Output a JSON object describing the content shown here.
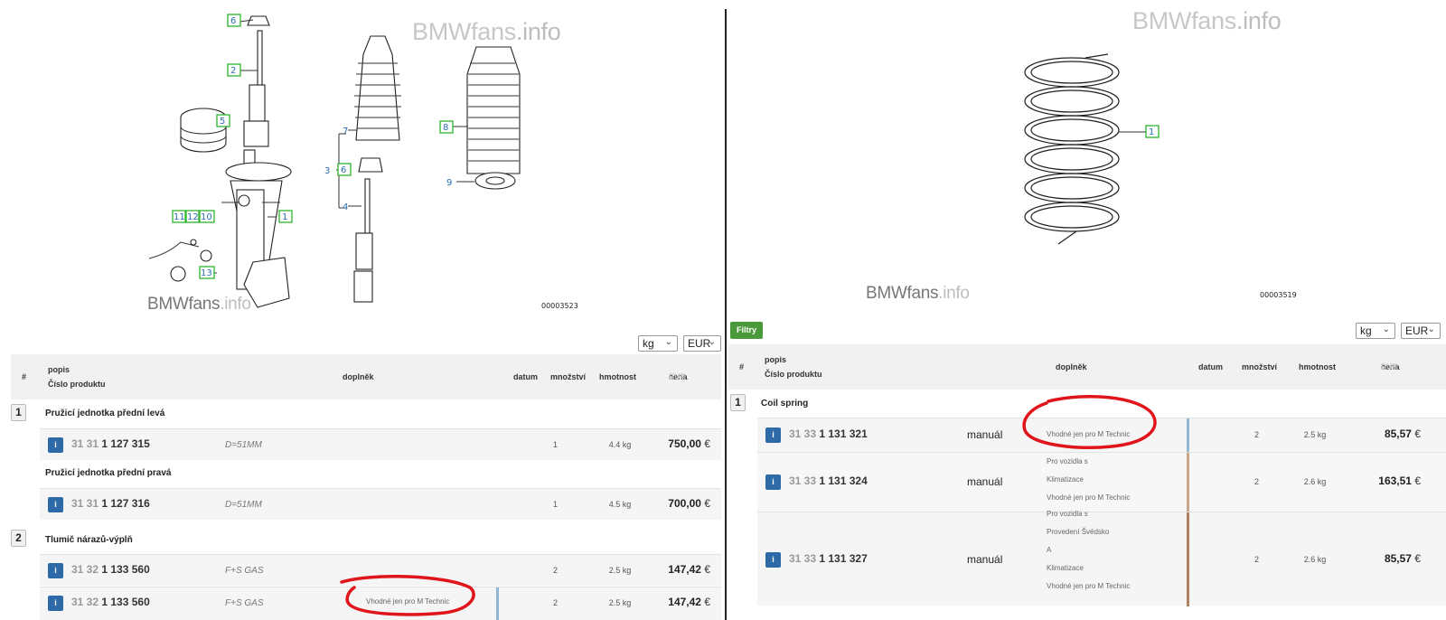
{
  "left": {
    "watermark_top": {
      "brand": "BMWfans",
      "domain": ".info"
    },
    "watermark_bottom": {
      "brand": "BMWfans",
      "domain": ".info"
    },
    "figure_number": "00003523",
    "callouts": [
      "6",
      "2",
      "5",
      "1",
      "11",
      "12",
      "10",
      "13",
      "7",
      "3",
      "6",
      "4",
      "8",
      "9"
    ],
    "unit_select": "kg",
    "currency_select": "EUR",
    "table_header": {
      "num": "#",
      "desc": "popis",
      "product": "Číslo produktu",
      "addition": "doplněk",
      "date": "datum",
      "qty": "množství",
      "weight": "hmotnost",
      "price": "cena",
      "price_currency": "EUR"
    },
    "groups": [
      {
        "number": "1",
        "title": "Pružicí jednotka přední levá"
      },
      {
        "title": "Pružicí jednotka přední pravá"
      },
      {
        "number": "2",
        "title": "Tlumič nárazů-výplň"
      }
    ],
    "rows": [
      {
        "info": "i",
        "pn_prefix": "31 31",
        "pn_main": "1 127 315",
        "spec": "D=51MM",
        "qty": "1",
        "weight": "4.4 kg",
        "price": "750,00",
        "cur": "€"
      },
      {
        "info": "i",
        "pn_prefix": "31 31",
        "pn_main": "1 127 316",
        "spec": "D=51MM",
        "qty": "1",
        "weight": "4.5 kg",
        "price": "700,00",
        "cur": "€"
      },
      {
        "info": "i",
        "pn_prefix": "31 32",
        "pn_main": "1 133 560",
        "spec": "F+S GAS",
        "qty": "2",
        "weight": "2.5 kg",
        "price": "147,42",
        "cur": "€"
      },
      {
        "info": "i",
        "pn_prefix": "31 32",
        "pn_main": "1 133 560",
        "spec": "F+S GAS",
        "note": "Vhodné jen pro M Technic",
        "qty": "2",
        "weight": "2.5 kg",
        "price": "147,42",
        "cur": "€"
      }
    ]
  },
  "right": {
    "watermark_top": {
      "brand": "BMWfans",
      "domain": ".info"
    },
    "watermark_bottom": {
      "brand": "BMWfans",
      "domain": ".info"
    },
    "figure_number": "00003519",
    "callouts": [
      "1"
    ],
    "filter_button": "Filtry",
    "unit_select": "kg",
    "currency_select": "EUR",
    "table_header": {
      "num": "#",
      "desc": "popis",
      "product": "Číslo produktu",
      "addition": "doplněk",
      "date": "datum",
      "qty": "množství",
      "weight": "hmotnost",
      "price": "cena",
      "price_currency": "EUR"
    },
    "groups": [
      {
        "number": "1",
        "title": "Coil spring"
      }
    ],
    "rows": [
      {
        "info": "i",
        "pn_prefix": "31 33",
        "pn_main": "1 131 321",
        "manual": "manuál",
        "notes": [
          "Vhodné jen pro M Technic"
        ],
        "qty": "2",
        "weight": "2.5 kg",
        "price": "85,57",
        "cur": "€"
      },
      {
        "info": "i",
        "pn_prefix": "31 33",
        "pn_main": "1 131 324",
        "manual": "manuál",
        "notes": [
          "Pro vozidla s",
          "Klimatizace",
          "Vhodné jen pro M Technic"
        ],
        "qty": "2",
        "weight": "2.6 kg",
        "price": "163,51",
        "cur": "€"
      },
      {
        "info": "i",
        "pn_prefix": "31 33",
        "pn_main": "1 131 327",
        "manual": "manuál",
        "notes": [
          "Pro vozidla s",
          "Provedení Švédsko",
          "A",
          "Klimatizace",
          "Vhodné jen pro M Technic"
        ],
        "qty": "2",
        "weight": "2.6 kg",
        "price": "85,57",
        "cur": "€"
      }
    ]
  },
  "colors": {
    "callout_border": "#2db52d",
    "callout_text": "#2a6fb0",
    "info_button": "#2f6aa8",
    "filter_button": "#4a9a3b",
    "red_annotation": "#e0141b"
  }
}
